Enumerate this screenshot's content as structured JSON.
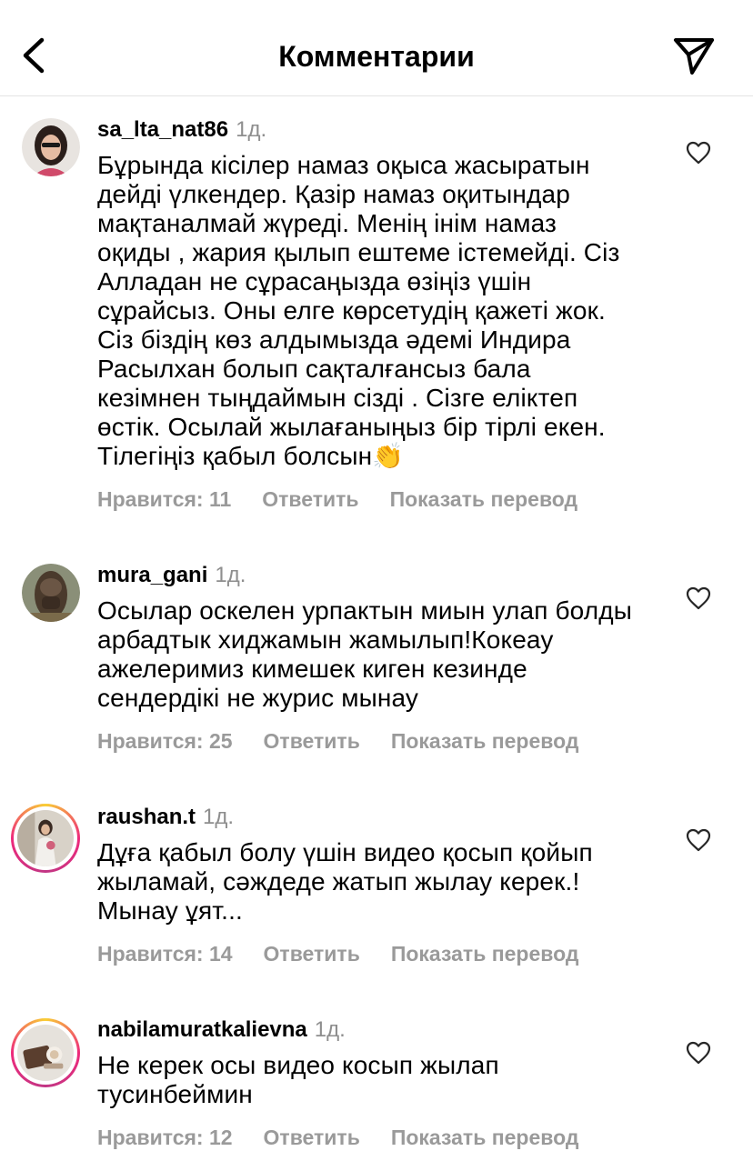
{
  "header": {
    "title": "Комментарии",
    "back_icon": "chevron-left-icon",
    "send_icon": "paper-plane-icon"
  },
  "comments": [
    {
      "username": "sa_lta_nat86",
      "time": "1д.",
      "lines": [
        "Бұрында кісілер намаз оқыса жасыратын",
        "дейді үлкендер. Қазір намаз оқитындар",
        "мақтаналмай жүреді. Менің інім намаз",
        "оқиды , жария қылып ештеме істемейді. Сіз",
        "Алладан не сұрасаңызда өзіңіз үшін",
        "сұрайсыз. Оны елге көрсетудің қажеті жок.",
        "Сіз біздің көз алдымызда әдемі Индира",
        "Расылхан болып сақталғансыз бала",
        "кезімнен тыңдаймын сізді . Сізге еліктеп",
        "өстік. Осылай жылағаныңыз бір тірлі екен.",
        "Тілегіңіз қабыл болсын"
      ],
      "emoji": "👏",
      "likes": "Нравится: 11",
      "reply": "Ответить",
      "translate": "Показать перевод"
    },
    {
      "username": "mura_gani",
      "time": "1д.",
      "lines": [
        "Осылар оскелен урпактын миын улап болды",
        "арбадтык хиджамын жамылып!Кокеау",
        "ажелеримиз кимешек киген кезинде",
        "сендердікі не журис мынау"
      ],
      "likes": "Нравится: 25",
      "reply": "Ответить",
      "translate": "Показать перевод"
    },
    {
      "username": "raushan.t",
      "time": "1д.",
      "lines": [
        "Дұға қабыл болу үшін видео қосып қойып",
        "жыламай, сәждеде жатып жылау керек.!",
        "Мынау ұят..."
      ],
      "likes": "Нравится: 14",
      "reply": "Ответить",
      "translate": "Показать перевод"
    },
    {
      "username": "nabilamuratkalievna",
      "time": "1д.",
      "lines": [
        "Не керек осы видео косып жылап",
        "тусинбеймин"
      ],
      "likes": "Нравится: 12",
      "reply": "Ответить",
      "translate": "Показать перевод"
    }
  ],
  "colors": {
    "secondary_text": "#8e8e8e",
    "action_text": "#9a9a9a",
    "story_ring": "#ee2a7b"
  }
}
